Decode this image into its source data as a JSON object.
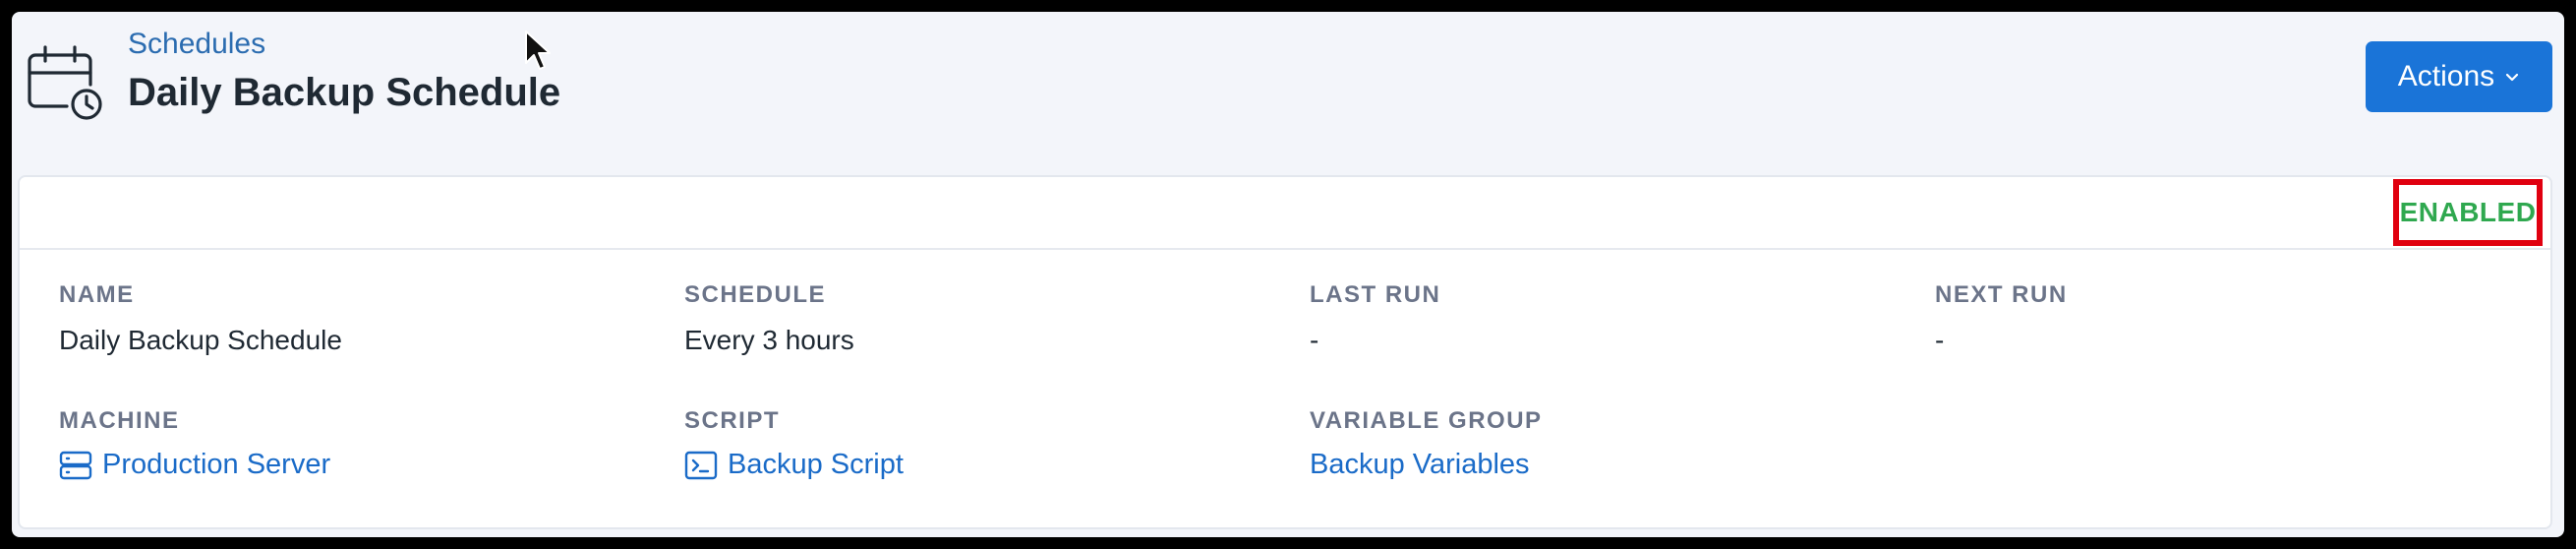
{
  "header": {
    "breadcrumb": "Schedules",
    "title": "Daily Backup Schedule",
    "actions_label": "Actions",
    "icon": "calendar-clock-icon"
  },
  "status": {
    "label": "ENABLED",
    "color": "#2fa84f",
    "highlight_color": "#e0000f"
  },
  "fields": {
    "name": {
      "label": "NAME",
      "value": "Daily Backup Schedule"
    },
    "schedule": {
      "label": "SCHEDULE",
      "value": "Every 3 hours"
    },
    "last_run": {
      "label": "LAST RUN",
      "value": "-"
    },
    "next_run": {
      "label": "NEXT RUN",
      "value": "-"
    },
    "machine": {
      "label": "MACHINE",
      "value": "Production Server",
      "icon": "server-icon"
    },
    "script": {
      "label": "SCRIPT",
      "value": "Backup Script",
      "icon": "terminal-icon"
    },
    "variable_group": {
      "label": "VARIABLE GROUP",
      "value": "Backup Variables"
    }
  },
  "colors": {
    "accent": "#1a74d8",
    "link": "#1a6bc8",
    "background": "#f3f5fa"
  }
}
